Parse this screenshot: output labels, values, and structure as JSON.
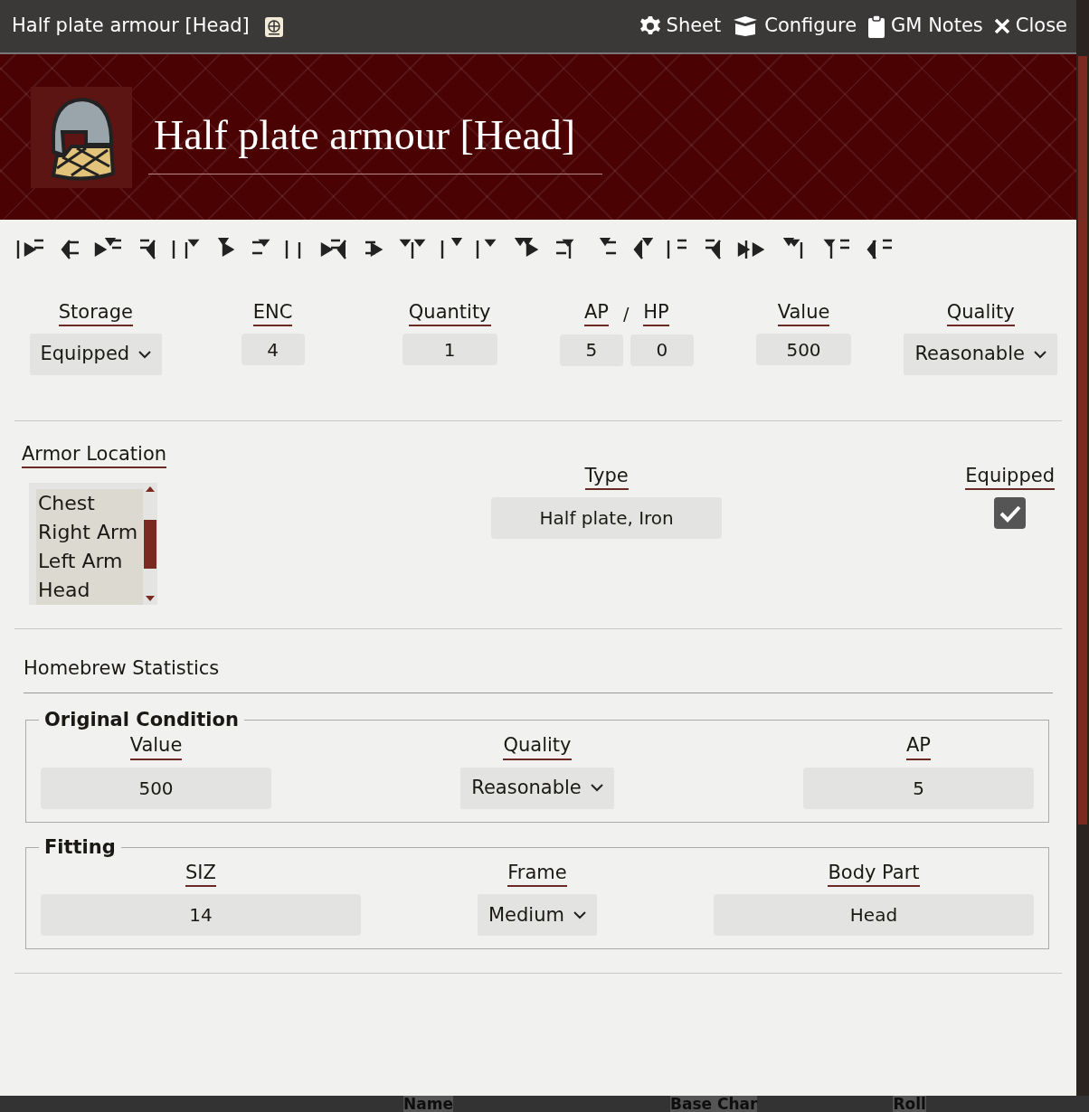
{
  "window": {
    "title": "Half plate armour [Head]",
    "header_buttons": [
      {
        "kind": "sheet",
        "label": "Sheet"
      },
      {
        "kind": "configure",
        "label": "Configure"
      },
      {
        "kind": "notes",
        "label": "GM Notes"
      },
      {
        "kind": "close",
        "label": "Close"
      }
    ]
  },
  "item": {
    "name": "Half plate armour [Head]"
  },
  "summary": [
    {
      "kind": "select",
      "label": "Storage",
      "value": "Equipped"
    },
    {
      "kind": "input",
      "label": "ENC",
      "value": "4"
    },
    {
      "kind": "input",
      "label": "Quantity",
      "value": "1"
    },
    {
      "kind": "pair",
      "labels": [
        "AP",
        "HP"
      ],
      "separator": "/",
      "values": [
        "5",
        "0"
      ]
    },
    {
      "kind": "input",
      "label": "Value",
      "value": "500"
    },
    {
      "kind": "select",
      "label": "Quality",
      "value": "Reasonable"
    }
  ],
  "armor_location": {
    "label": "Armor Location",
    "options": [
      {
        "label": "Chest",
        "selected": true
      },
      {
        "label": "Right Arm",
        "selected": true
      },
      {
        "label": "Left Arm",
        "selected": true
      },
      {
        "label": "Head",
        "selected": true
      }
    ]
  },
  "type": {
    "label": "Type",
    "value": "Half plate, Iron"
  },
  "equipped": {
    "label": "Equipped",
    "checked": true
  },
  "homebrew": {
    "title": "Homebrew Statistics",
    "groups": [
      {
        "legend": "Original Condition",
        "fields": [
          {
            "kind": "input",
            "label": "Value",
            "value": "500"
          },
          {
            "kind": "select",
            "label": "Quality",
            "value": "Reasonable"
          },
          {
            "kind": "input",
            "label": "AP",
            "value": "5"
          }
        ]
      },
      {
        "legend": "Fitting",
        "fields": [
          {
            "kind": "input",
            "label": "SIZ",
            "value": "14"
          },
          {
            "kind": "select",
            "label": "Frame",
            "value": "Medium"
          },
          {
            "kind": "input",
            "label": "Body Part",
            "value": "Head"
          }
        ]
      }
    ]
  },
  "footer_bar": {
    "columns": [
      "Name",
      "Base Char",
      "Roll"
    ]
  }
}
